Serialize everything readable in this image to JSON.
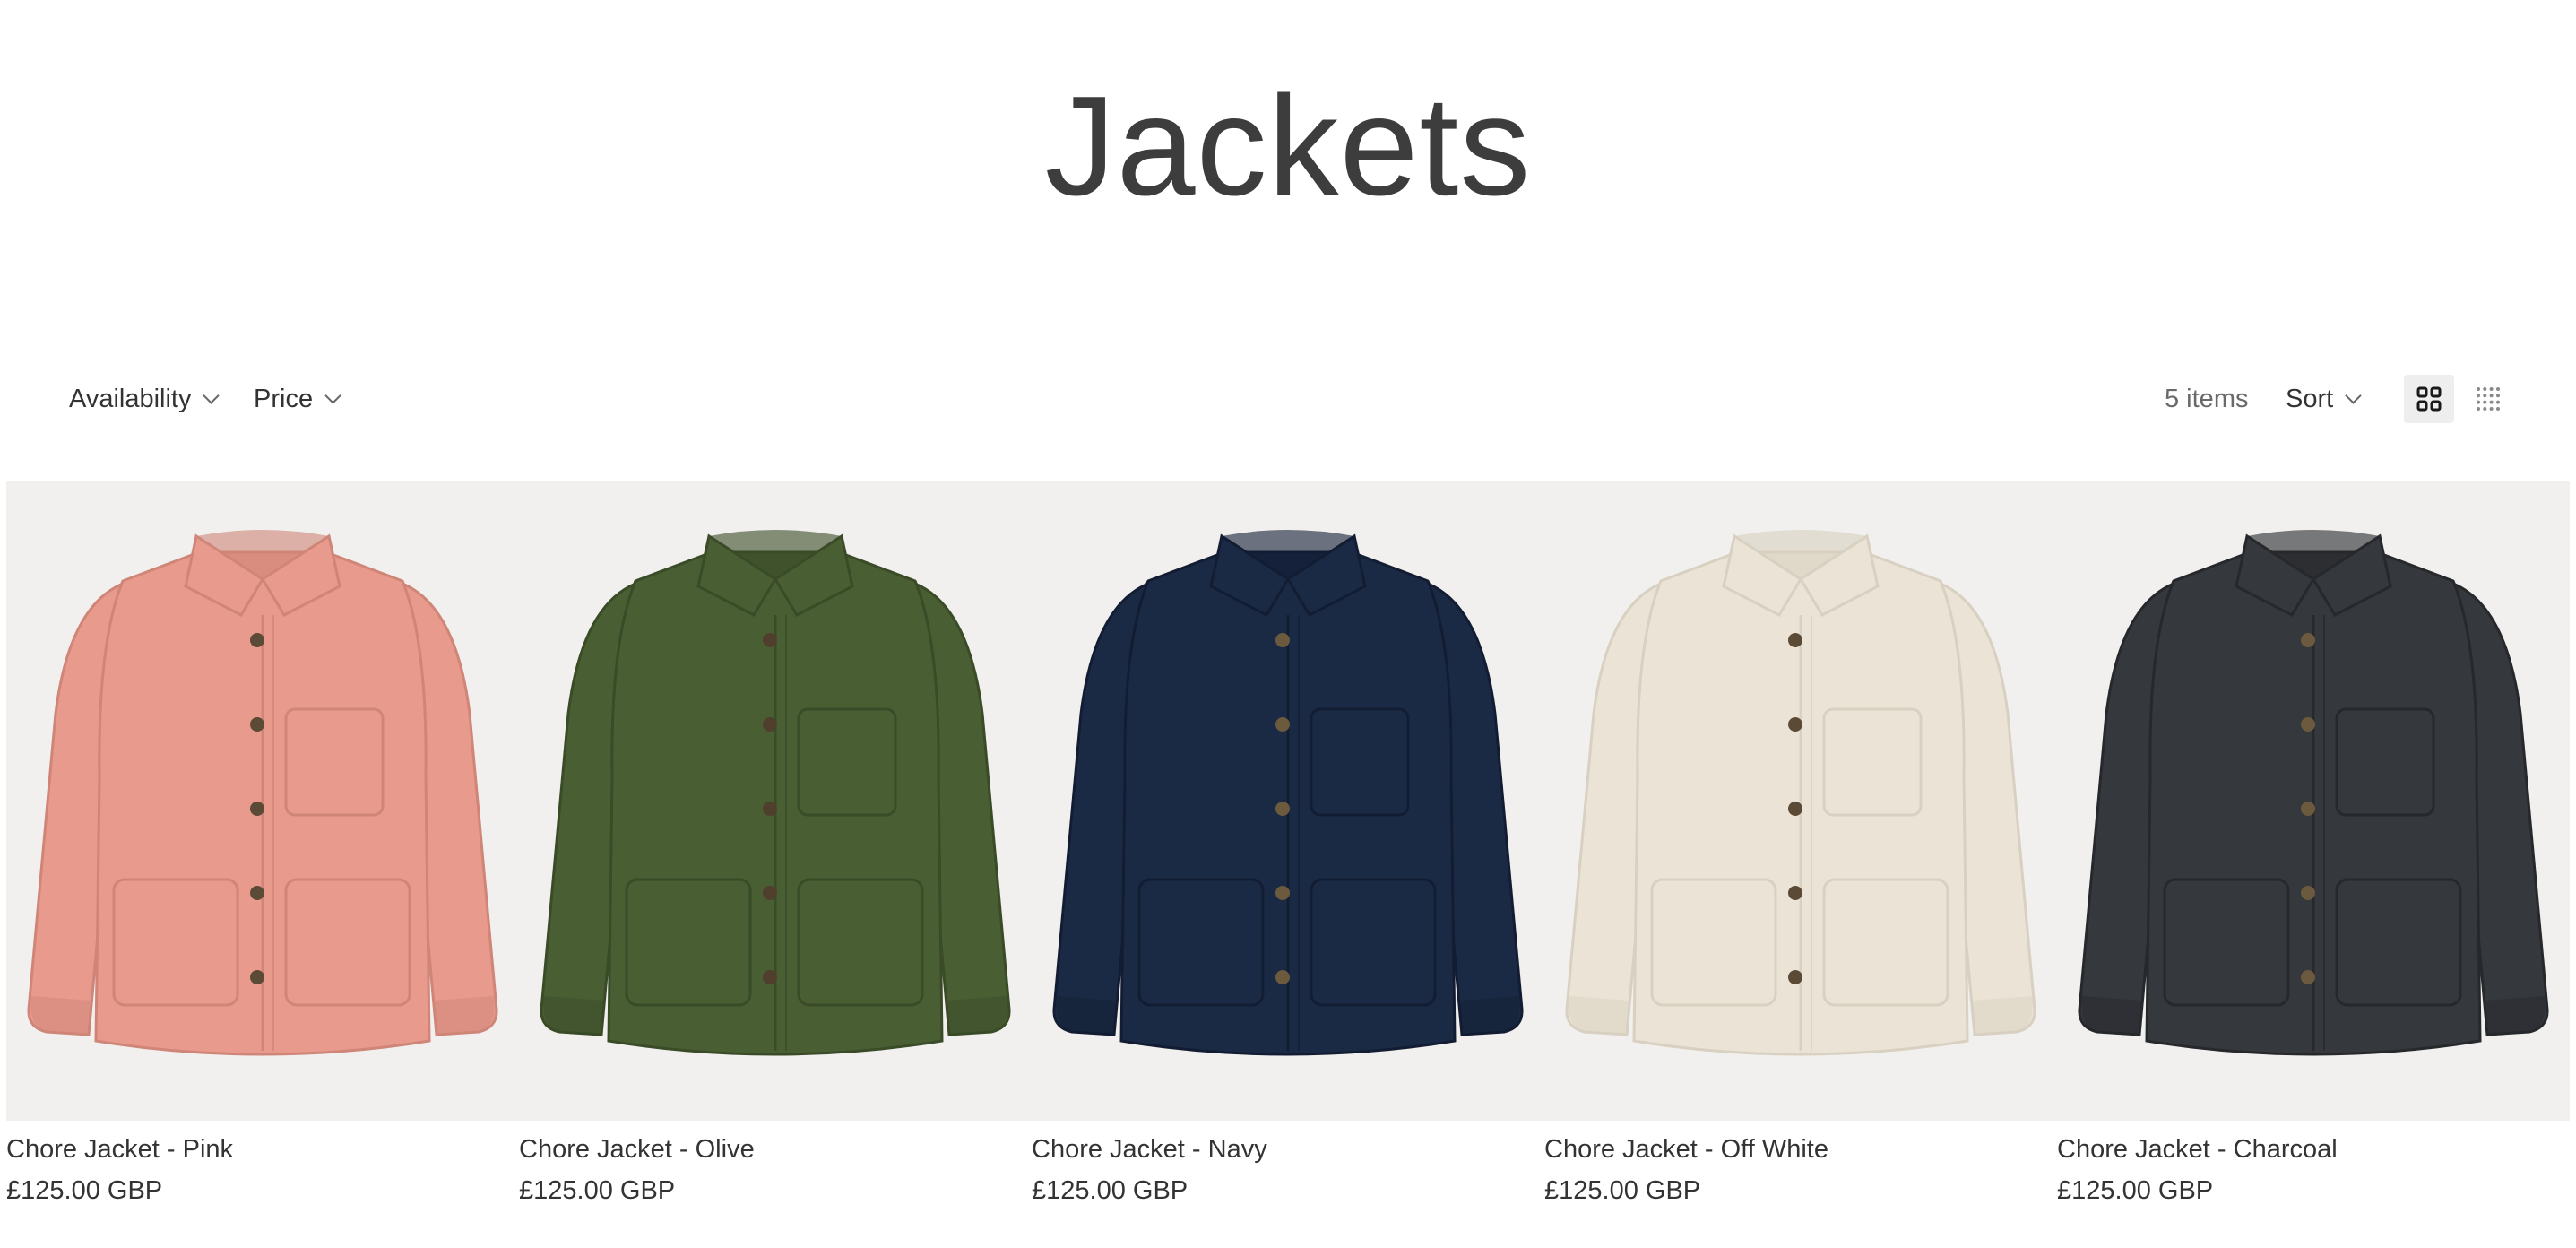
{
  "page": {
    "title": "Jackets"
  },
  "filters": [
    {
      "label": "Availability"
    },
    {
      "label": "Price"
    }
  ],
  "toolbar": {
    "item_count": "5 items",
    "sort_label": "Sort",
    "views": [
      {
        "name": "grid-large",
        "icon": "grid-2x2-icon",
        "active": true
      },
      {
        "name": "grid-small",
        "icon": "grid-dots-icon",
        "active": false
      }
    ]
  },
  "products": [
    {
      "name": "Chore Jacket - Pink",
      "price": "£125.00 GBP",
      "color": "#e89a8c",
      "dark": "#cf8577",
      "button": "#5b4a36"
    },
    {
      "name": "Chore Jacket - Olive",
      "price": "£125.00 GBP",
      "color": "#4a5e33",
      "dark": "#3a4b27",
      "button": "#4f3f2c"
    },
    {
      "name": "Chore Jacket - Navy",
      "price": "£125.00 GBP",
      "color": "#1b2a44",
      "dark": "#121d33",
      "button": "#6b5a3e"
    },
    {
      "name": "Chore Jacket - Off White",
      "price": "£125.00 GBP",
      "color": "#ebe4d6",
      "dark": "#d8d0c0",
      "button": "#5b4a36"
    },
    {
      "name": "Chore Jacket - Charcoal",
      "price": "£125.00 GBP",
      "color": "#35383d",
      "dark": "#26282c",
      "button": "#6b5a3e"
    }
  ]
}
